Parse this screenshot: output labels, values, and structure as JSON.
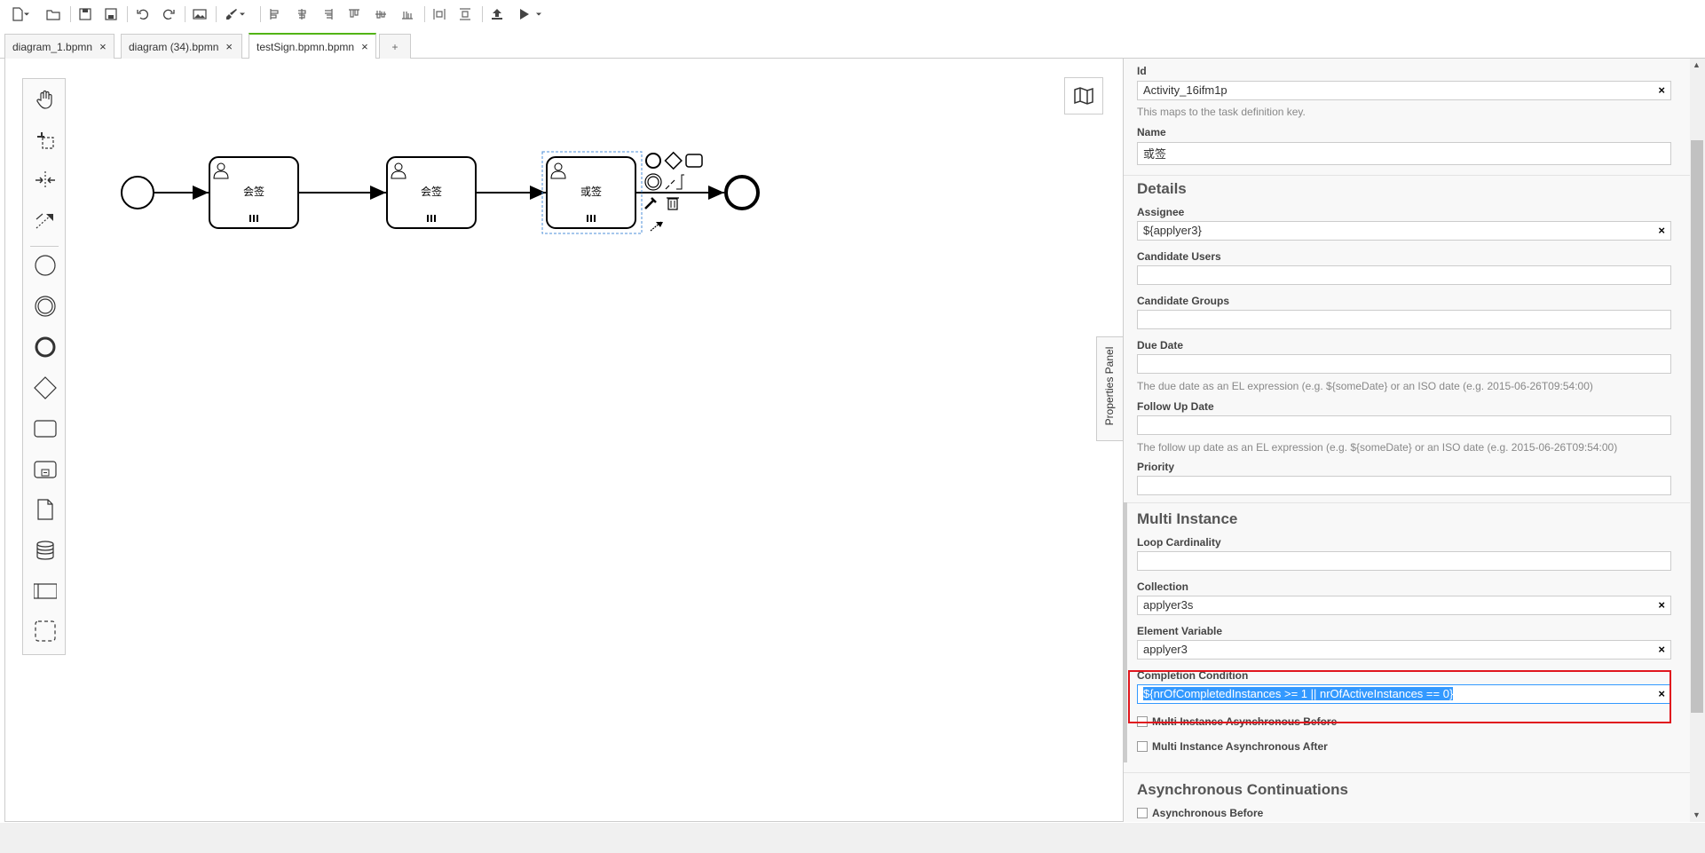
{
  "tabs": [
    {
      "label": "diagram_1.bpmn",
      "close": "×"
    },
    {
      "label": "diagram (34).bpmn",
      "close": "×"
    },
    {
      "label": "testSign.bpmn.bpmn",
      "close": "×"
    }
  ],
  "tab_add": "+",
  "diagram": {
    "tasks": [
      {
        "label": "会签"
      },
      {
        "label": "会签"
      },
      {
        "label": "或签"
      }
    ]
  },
  "properties_toggle": "Properties Panel",
  "properties": {
    "id_label": "Id",
    "id_value": "Activity_16ifm1p",
    "id_desc": "This maps to the task definition key.",
    "name_label": "Name",
    "name_value": "或签",
    "details_title": "Details",
    "assignee_label": "Assignee",
    "assignee_value": "${applyer3}",
    "candidate_users_label": "Candidate Users",
    "candidate_groups_label": "Candidate Groups",
    "due_date_label": "Due Date",
    "due_date_desc": "The due date as an EL expression (e.g. ${someDate} or an ISO date (e.g. 2015-06-26T09:54:00)",
    "follow_up_label": "Follow Up Date",
    "follow_up_desc": "The follow up date as an EL expression (e.g. ${someDate} or an ISO date (e.g. 2015-06-26T09:54:00)",
    "priority_label": "Priority",
    "multi_instance_title": "Multi Instance",
    "loop_cardinality_label": "Loop Cardinality",
    "collection_label": "Collection",
    "collection_value": "applyer3s",
    "element_variable_label": "Element Variable",
    "element_variable_value": "applyer3",
    "completion_condition_label": "Completion Condition",
    "completion_condition_value": "${nrOfCompletedInstances >= 1 || nrOfActiveInstances == 0}",
    "mi_async_before": "Multi Instance Asynchronous Before",
    "mi_async_after": "Multi Instance Asynchronous After",
    "async_title": "Asynchronous Continuations",
    "async_before": "Asynchronous Before",
    "clear": "×"
  },
  "colors": {
    "accent": "#52b415",
    "highlight": "#e0161e",
    "selection": "#3399ff"
  }
}
